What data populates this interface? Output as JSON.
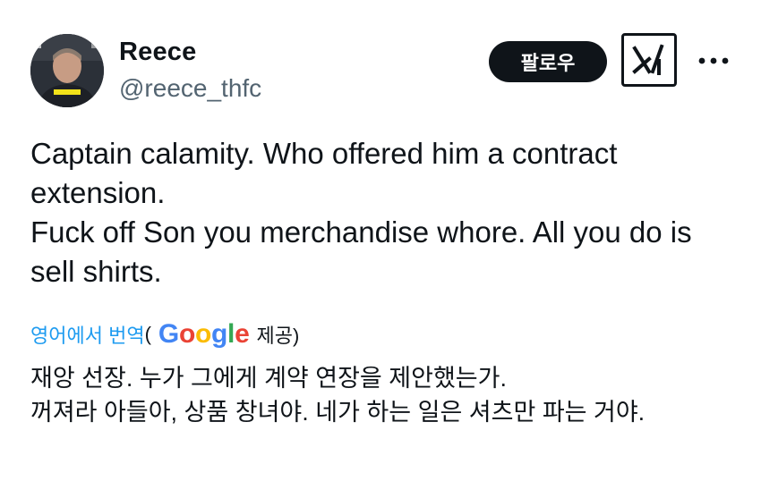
{
  "author": {
    "display_name": "Reece",
    "handle": "@reece_thfc",
    "avatar_icon": "person-avatar"
  },
  "actions": {
    "follow_label": "팔로우",
    "grok_icon": "grok-icon",
    "more_icon": "more-dots-icon"
  },
  "tweet": {
    "lines": [
      "Captain calamity. Who offered him a contract extension.",
      "Fuck off Son you merchandise whore. All you do is sell shirts."
    ]
  },
  "translate": {
    "link_text": "영어에서 번역",
    "open_paren": "(",
    "provider": "Google",
    "suffix": " 제공)"
  },
  "translation": {
    "lines": [
      "재앙 선장. 누가 그에게 계약 연장을 제안했는가.",
      "꺼져라 아들아, 상품 창녀야. 네가 하는 일은 셔츠만 파는 거야."
    ]
  },
  "colors": {
    "accent": "#1d9bf0",
    "text_primary": "#0f1419",
    "text_secondary": "#536471",
    "google_blue": "#4285f4",
    "google_red": "#ea4335",
    "google_yellow": "#fbbc05",
    "google_green": "#34a853"
  }
}
